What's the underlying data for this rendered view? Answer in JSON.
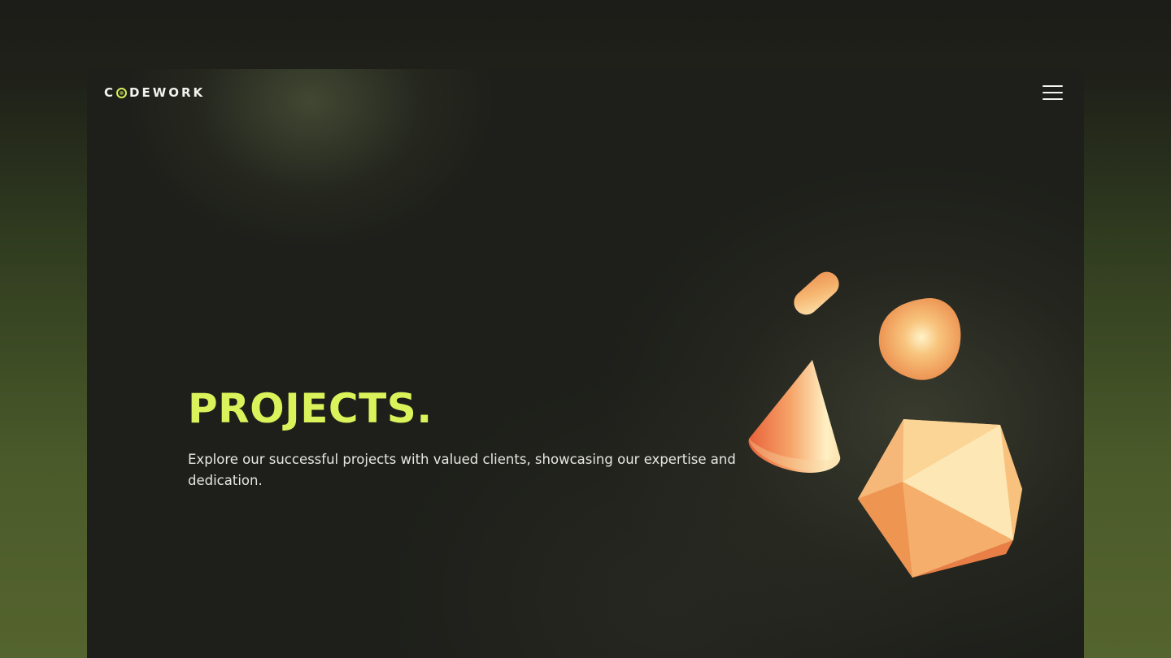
{
  "brand": {
    "logo_left": "C",
    "logo_right": "DEWORK",
    "accent_color": "#dbf35a"
  },
  "nav": {
    "menu_icon": "hamburger-menu-icon"
  },
  "hero": {
    "title": "PROJECTS.",
    "description": "Explore our successful projects with valued clients, showcasing our expertise and dedication."
  },
  "illustration": {
    "shapes": [
      "capsule",
      "sphere",
      "cone",
      "icosahedron"
    ],
    "color": "#f2a45c"
  }
}
